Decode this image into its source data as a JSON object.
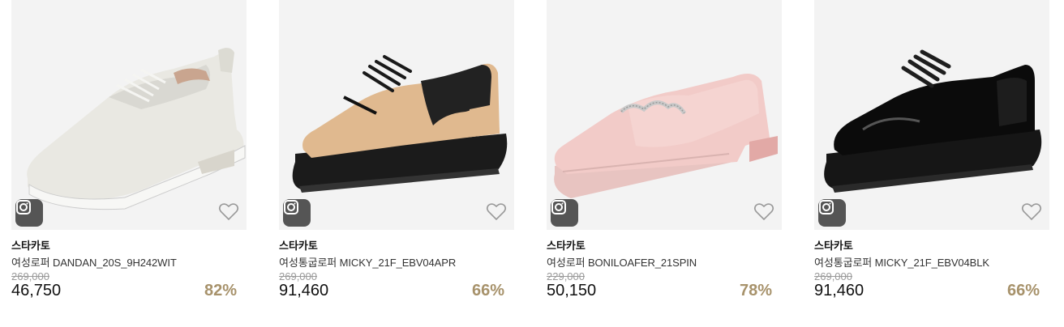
{
  "colors": {
    "image_bg": "#f3f3f3",
    "discount": "#a7926b",
    "badge_bg": "#555555"
  },
  "products": [
    {
      "brand": "스타카토",
      "name": "여성로퍼 DANDAN_20S_9H242WIT",
      "original_price": "269,000",
      "price": "46,750",
      "discount": "82%",
      "color": "white",
      "badge_icon": "camera-icon",
      "wish_icon": "heart-outline-icon"
    },
    {
      "brand": "스타카토",
      "name": "여성통굽로퍼 MICKY_21F_EBV04APR",
      "original_price": "269,000",
      "price": "91,460",
      "discount": "66%",
      "color": "beige-black",
      "badge_icon": "camera-icon",
      "wish_icon": "heart-outline-icon"
    },
    {
      "brand": "스타카토",
      "name": "여성로퍼 BONILOAFER_21SPIN",
      "original_price": "229,000",
      "price": "50,150",
      "discount": "78%",
      "color": "pink",
      "badge_icon": "camera-icon",
      "wish_icon": "heart-outline-icon"
    },
    {
      "brand": "스타카토",
      "name": "여성통굽로퍼 MICKY_21F_EBV04BLK",
      "original_price": "269,000",
      "price": "91,460",
      "discount": "66%",
      "color": "black",
      "badge_icon": "camera-icon",
      "wish_icon": "heart-outline-icon"
    }
  ]
}
